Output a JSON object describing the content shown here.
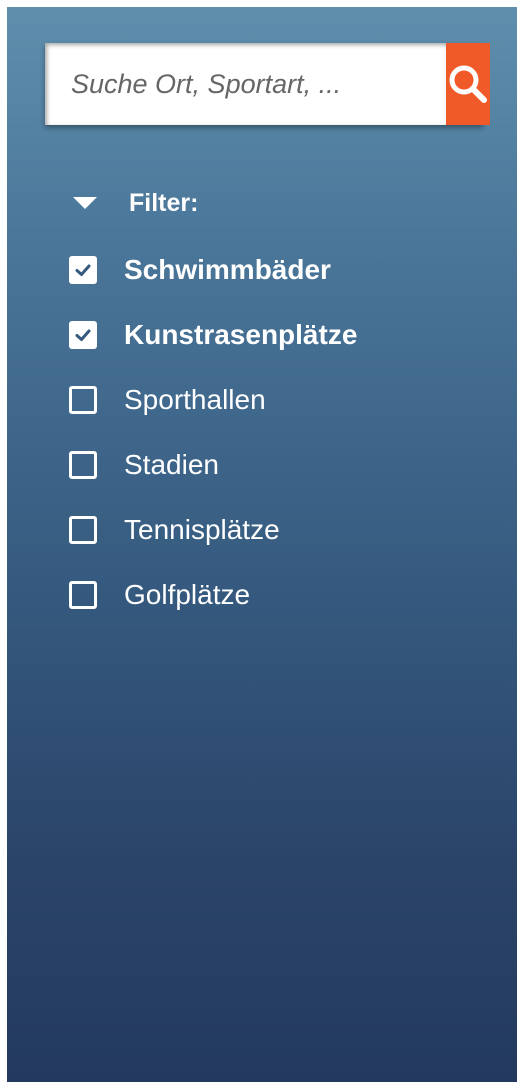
{
  "search": {
    "placeholder": "Suche Ort, Sportart, ...",
    "value": "",
    "button_icon": "search-icon",
    "button_color": "#f05a28"
  },
  "filter": {
    "title": "Filter:",
    "expanded": true,
    "items": [
      {
        "label": "Schwimmbäder",
        "checked": true
      },
      {
        "label": "Kunstrasenplätze",
        "checked": true
      },
      {
        "label": "Sporthallen",
        "checked": false
      },
      {
        "label": "Stadien",
        "checked": false
      },
      {
        "label": "Tennisplätze",
        "checked": false
      },
      {
        "label": "Golfplätze",
        "checked": false
      }
    ]
  },
  "colors": {
    "panel_top": "#5f8fad",
    "panel_bottom": "#233a5e",
    "text": "#ffffff",
    "accent": "#f05a28"
  }
}
